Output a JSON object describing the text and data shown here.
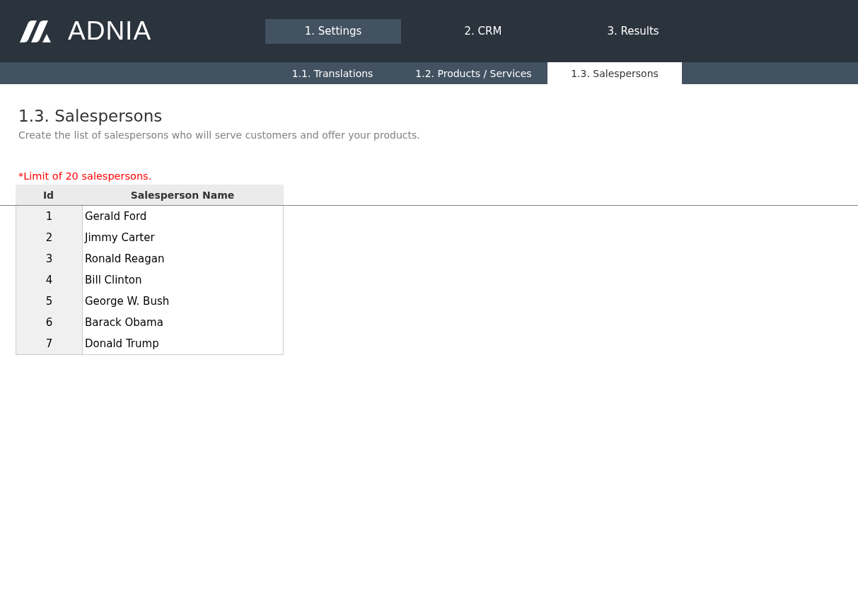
{
  "logo": {
    "text": "ADNIA"
  },
  "main_tabs": [
    {
      "label": "1. Settings",
      "selected": true
    },
    {
      "label": "2. CRM",
      "selected": false
    },
    {
      "label": "3. Results",
      "selected": false
    }
  ],
  "sub_tabs": [
    {
      "label": "1.1. Translations",
      "selected": false
    },
    {
      "label": "1.2. Products / Services",
      "selected": false
    },
    {
      "label": "1.3. Salespersons",
      "selected": true
    }
  ],
  "page": {
    "title": "1.3. Salespersons",
    "subtitle": "Create the list of salespersons who will serve customers and offer your products.",
    "note": "*Limit of 20 salespersons."
  },
  "table": {
    "columns": [
      "Id",
      "Salesperson Name"
    ],
    "rows": [
      [
        "1",
        "Gerald Ford"
      ],
      [
        "2",
        "Jimmy Carter"
      ],
      [
        "3",
        "Ronald Reagan"
      ],
      [
        "4",
        "Bill Clinton"
      ],
      [
        "5",
        "George W. Bush"
      ],
      [
        "6",
        "Barack Obama"
      ],
      [
        "7",
        "Donald Trump"
      ]
    ]
  }
}
